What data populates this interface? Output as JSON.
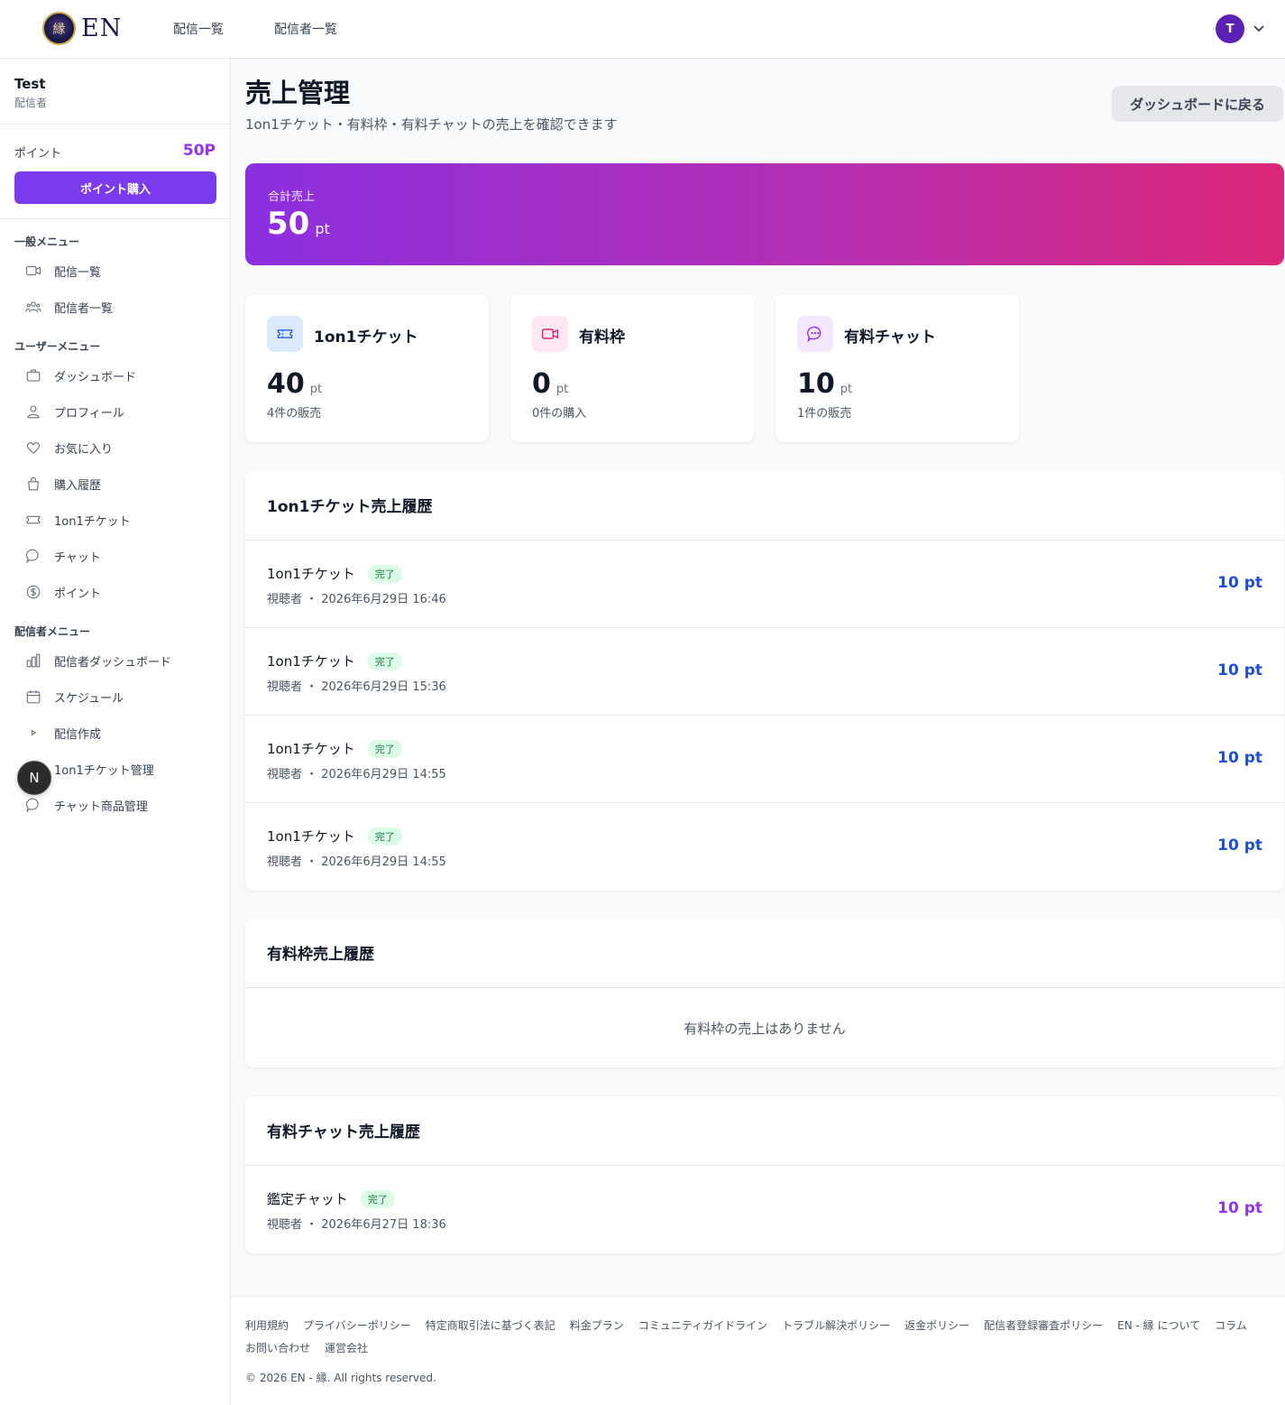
{
  "header": {
    "logo_text": "EN",
    "logo_mark": "縁",
    "nav": [
      "配信一覧",
      "配信者一覧"
    ],
    "avatar_initial": "T"
  },
  "sidebar": {
    "user_name": "Test",
    "user_role": "配信者",
    "points_label": "ポイント",
    "points_value": "50P",
    "buy_button": "ポイント購入",
    "sections": [
      {
        "title": "一般メニュー",
        "items": [
          {
            "label": "配信一覧",
            "icon": "video-icon"
          },
          {
            "label": "配信者一覧",
            "icon": "users-icon"
          }
        ]
      },
      {
        "title": "ユーザーメニュー",
        "items": [
          {
            "label": "ダッシュボード",
            "icon": "briefcase-icon"
          },
          {
            "label": "プロフィール",
            "icon": "user-icon"
          },
          {
            "label": "お気に入り",
            "icon": "heart-icon"
          },
          {
            "label": "購入履歴",
            "icon": "bag-icon"
          },
          {
            "label": "1on1チケット",
            "icon": "ticket-icon"
          },
          {
            "label": "チャット",
            "icon": "chat-icon"
          },
          {
            "label": "ポイント",
            "icon": "dollar-icon"
          }
        ]
      },
      {
        "title": "配信者メニュー",
        "items": [
          {
            "label": "配信者ダッシュボード",
            "icon": "bar-chart-icon"
          },
          {
            "label": "スケジュール",
            "icon": "calendar-icon"
          },
          {
            "label": "配信作成",
            "icon": "play-icon"
          },
          {
            "label": "1on1チケット管理",
            "icon": "ticket-icon"
          },
          {
            "label": "チャット商品管理",
            "icon": "chat-icon"
          }
        ]
      }
    ],
    "floating_badge": "N"
  },
  "main": {
    "title": "売上管理",
    "subtitle": "1on1チケット・有料枠・有料チャットの売上を確認できます",
    "back_button": "ダッシュボードに戻る",
    "total": {
      "label": "合計売上",
      "value": "50",
      "unit": "pt"
    },
    "stats": [
      {
        "title": "1on1チケット",
        "value": "40",
        "unit": "pt",
        "sub": "4件の販売",
        "icon": "ticket-icon",
        "bg": "#dbeafe",
        "color": "#2563eb"
      },
      {
        "title": "有料枠",
        "value": "0",
        "unit": "pt",
        "sub": "0件の購入",
        "icon": "video-icon",
        "bg": "#fce7f3",
        "color": "#db2777"
      },
      {
        "title": "有料チャット",
        "value": "10",
        "unit": "pt",
        "sub": "1件の販売",
        "icon": "chat-icon",
        "bg": "#f3e8ff",
        "color": "#9333ea"
      }
    ],
    "ticket_history": {
      "title": "1on1チケット売上履歴",
      "rows": [
        {
          "name": "1on1チケット",
          "status": "完了",
          "meta": "視聴者 ・ 2026年6月29日 16:46",
          "amount": "10 pt"
        },
        {
          "name": "1on1チケット",
          "status": "完了",
          "meta": "視聴者 ・ 2026年6月29日 15:36",
          "amount": "10 pt"
        },
        {
          "name": "1on1チケット",
          "status": "完了",
          "meta": "視聴者 ・ 2026年6月29日 14:55",
          "amount": "10 pt"
        },
        {
          "name": "1on1チケット",
          "status": "完了",
          "meta": "視聴者 ・ 2026年6月29日 14:55",
          "amount": "10 pt"
        }
      ]
    },
    "slot_history": {
      "title": "有料枠売上履歴",
      "empty": "有料枠の売上はありません"
    },
    "chat_history": {
      "title": "有料チャット売上履歴",
      "rows": [
        {
          "name": "鑑定チャット",
          "status": "完了",
          "meta": "視聴者 ・ 2026年6月27日 18:36",
          "amount": "10 pt"
        }
      ]
    }
  },
  "footer": {
    "links": [
      "利用規約",
      "プライバシーポリシー",
      "特定商取引法に基づく表記",
      "料金プラン",
      "コミュニティガイドライン",
      "トラブル解決ポリシー",
      "返金ポリシー",
      "配信者登録審査ポリシー",
      "EN - 縁 について",
      "コラム",
      "お問い合わせ",
      "運営会社"
    ],
    "copyright": "© 2026 EN - 縁. All rights reserved."
  },
  "colors": {
    "accent": "#7c3aed",
    "ticket_amount": "#1d4ed8",
    "chat_amount": "#9333ea",
    "status_bg": "#dcfce7",
    "status_text": "#15803d"
  }
}
